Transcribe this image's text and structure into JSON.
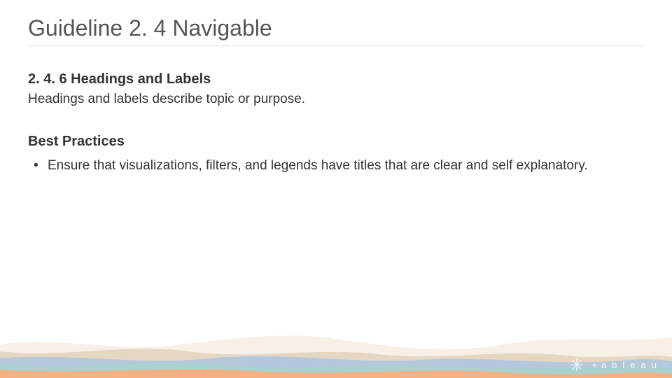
{
  "slide": {
    "title": "Guideline 2. 4 Navigable",
    "section": {
      "heading": "2. 4. 6 Headings and Labels",
      "description": "Headings and labels describe topic or purpose."
    },
    "best_practices": {
      "heading": "Best Practices",
      "items": [
        "Ensure that visualizations, filters, and legends have titles that are clear and self explanatory."
      ]
    }
  },
  "brand": {
    "plus": "+",
    "name": "ableau"
  },
  "colors": {
    "wave_orange": "#f4b183",
    "wave_blue": "#b4c7dc",
    "wave_teal": "#a9d1d0",
    "wave_cream": "#f8efe6",
    "wave_tan": "#e6d7c3"
  }
}
